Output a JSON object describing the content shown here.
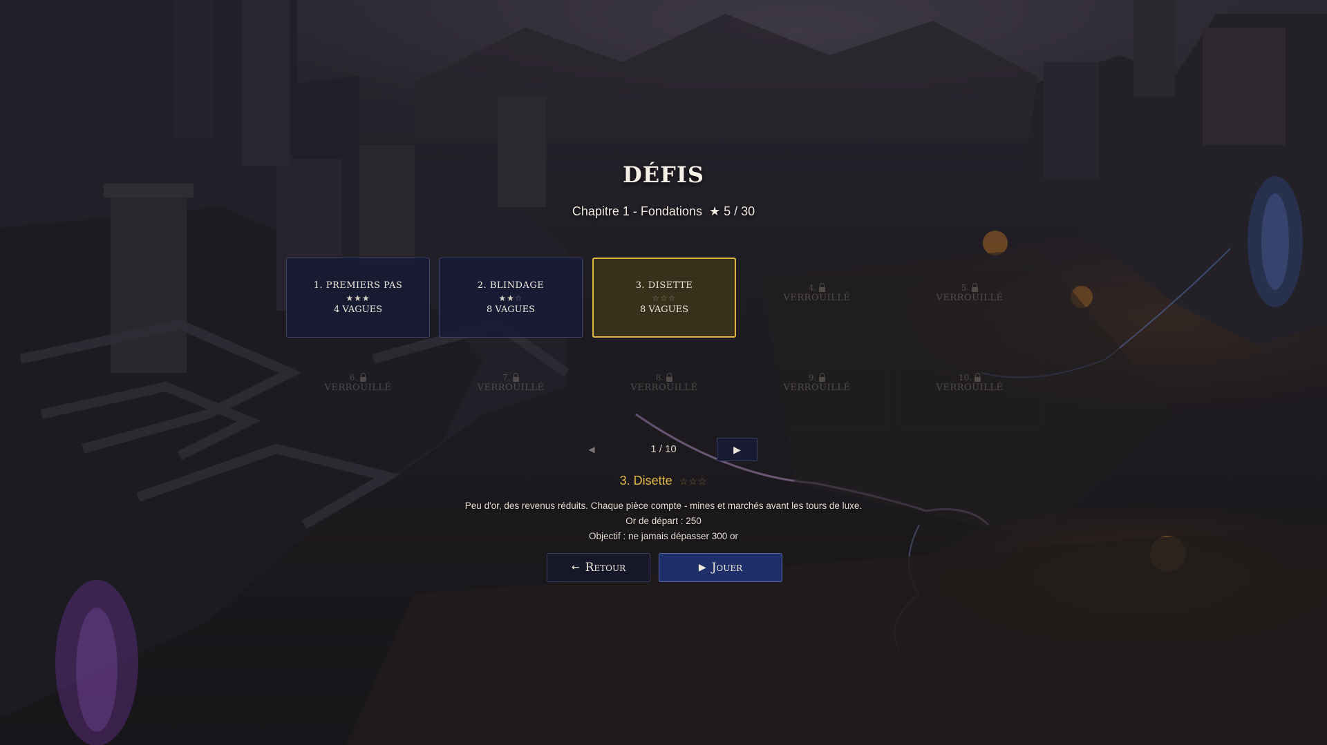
{
  "screen": {
    "title": "DÉFIS",
    "chapter": "Chapitre 1 - Fondations",
    "star_total": "★ 5 / 30"
  },
  "levels_row1": [
    {
      "name": "1. PREMIERS PAS",
      "stars": "★★★",
      "stars_off": "",
      "waves": "4 VAGUES",
      "state": "unlocked"
    },
    {
      "name": "2. BLINDAGE",
      "stars": "★★",
      "stars_off": "☆",
      "waves": "8 VAGUES",
      "state": "unlocked"
    },
    {
      "name": "3. DISETTE",
      "stars": "",
      "stars_off": "☆☆☆",
      "waves": "8 VAGUES",
      "state": "selected"
    },
    {
      "num": "4.",
      "label": "VERROUILLÉ",
      "state": "locked"
    },
    {
      "num": "5.",
      "label": "VERROUILLÉ",
      "state": "locked"
    }
  ],
  "levels_row2": [
    {
      "num": "6.",
      "label": "VERROUILLÉ",
      "state": "locked"
    },
    {
      "num": "7.",
      "label": "VERROUILLÉ",
      "state": "locked"
    },
    {
      "num": "8.",
      "label": "VERROUILLÉ",
      "state": "locked"
    },
    {
      "num": "9.",
      "label": "VERROUILLÉ",
      "state": "locked"
    },
    {
      "num": "10.",
      "label": "VERROUILLÉ",
      "state": "locked"
    }
  ],
  "pager": {
    "prev": "◀",
    "text": "1 / 10",
    "next": "▶"
  },
  "detail": {
    "title": "3. Disette",
    "stars": "☆☆☆",
    "description": "Peu d'or, des revenus réduits. Chaque pièce compte - mines et marchés avant les tours de luxe.",
    "gold": "Or de départ : 250",
    "objective": "Objectif : ne jamais dépasser 300 or"
  },
  "buttons": {
    "back_icon": "←",
    "back_label": "Retour",
    "play_icon": "▶",
    "play_label": "Jouer"
  },
  "colors": {
    "accent_gold": "#e0b640",
    "card_bg": "#181b34",
    "play_bg": "#1e2f6a"
  },
  "icons": [
    "lock-icon",
    "star-icon",
    "arrow-left-icon",
    "play-icon"
  ]
}
